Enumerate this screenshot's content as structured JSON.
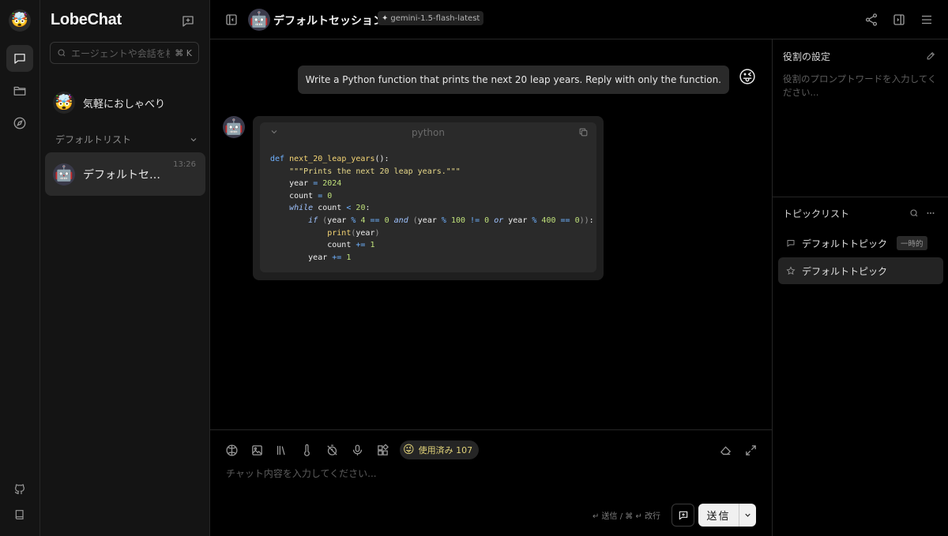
{
  "app": {
    "name": "LobeChat"
  },
  "sidebar": {
    "search_placeholder": "エージェントや会話を検索",
    "search_shortcut": "⌘ K",
    "inbox_label": "気軽におしゃべり",
    "group_label": "デフォルトリスト",
    "sessions": [
      {
        "title": "デフォルトセッション",
        "time": "13:26"
      }
    ]
  },
  "header": {
    "title": "デフォルトセッション",
    "model": "gemini-1.5-flash-latest"
  },
  "chat": {
    "user_message": "Write a Python function that prints the next 20 leap years. Reply with only the function.",
    "code_language": "python"
  },
  "composer": {
    "token_label": "使用済み 107",
    "placeholder": "チャット内容を入力してください...",
    "hint": "↵ 送信 / ⌘ ↵ 改行",
    "send_label": "送信"
  },
  "right_panel": {
    "role_title": "役割の設定",
    "role_placeholder": "役割のプロンプトワードを入力してください...",
    "topics_title": "トピックリスト",
    "topics": [
      {
        "label": "デフォルトトピック",
        "tag": "一時的"
      },
      {
        "label": "デフォルトトピック"
      }
    ]
  },
  "colors": {
    "background": "#000000",
    "panel": "#141414",
    "accent": "#e0d178"
  }
}
